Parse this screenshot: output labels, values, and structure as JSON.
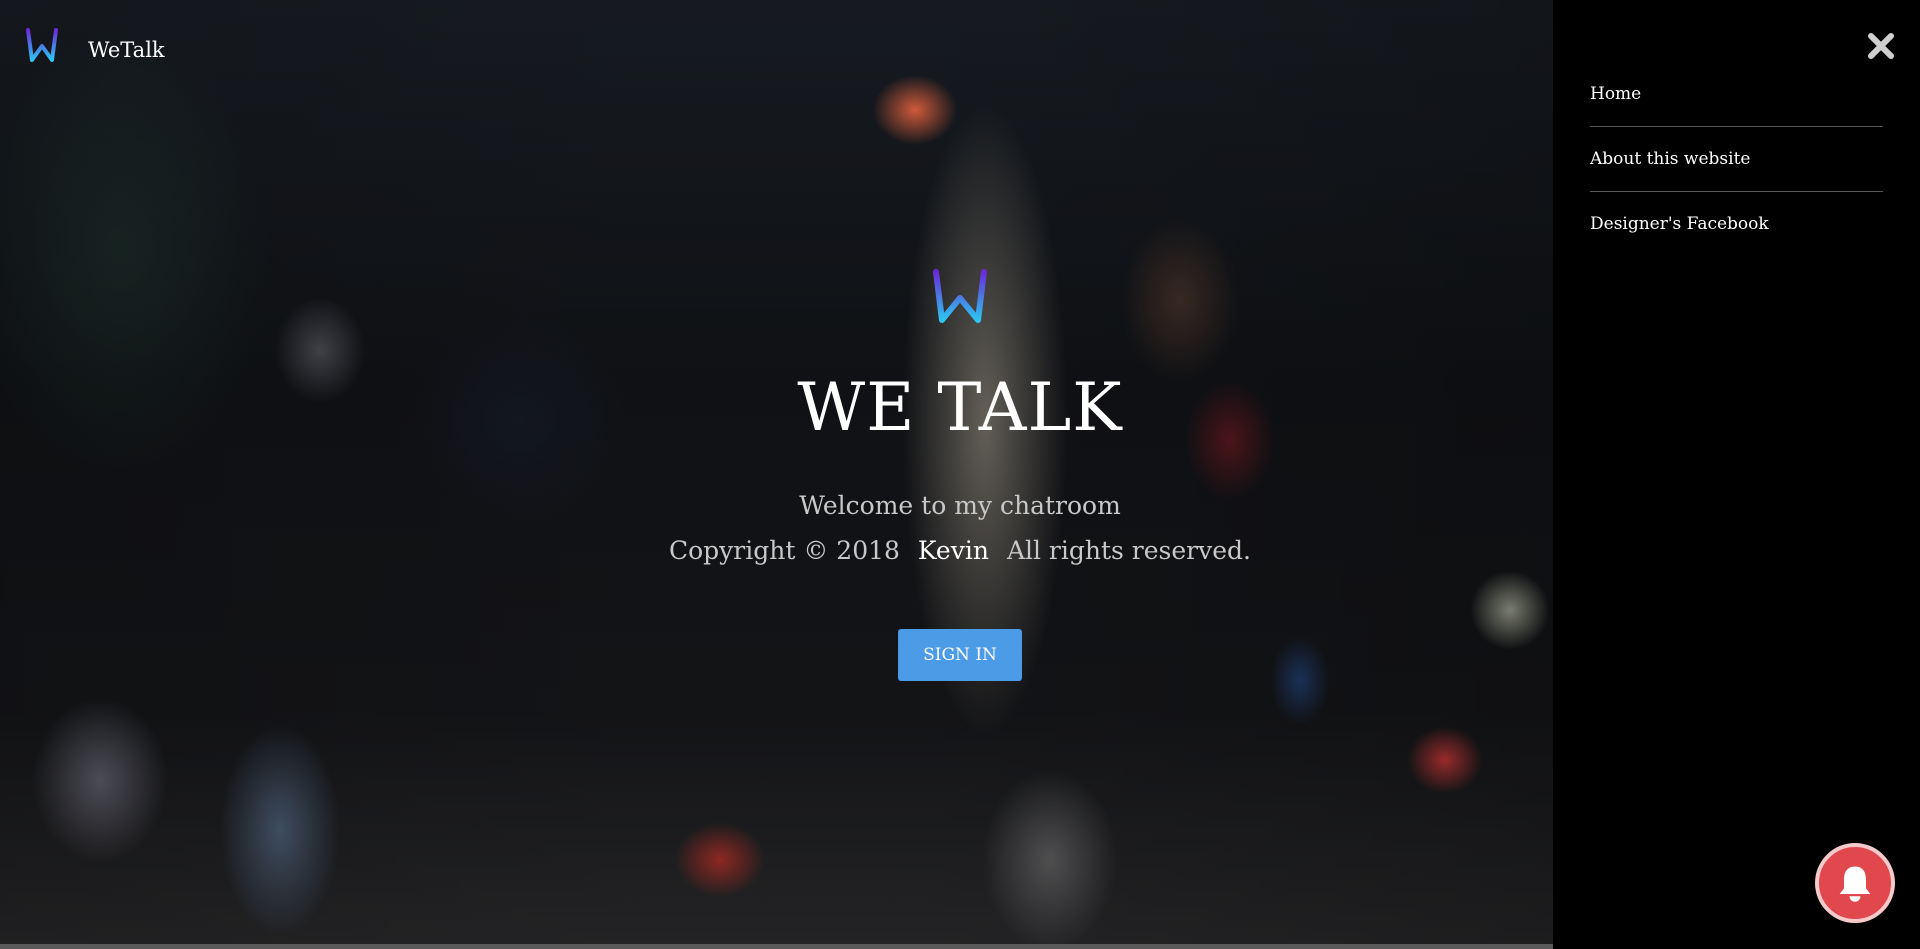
{
  "brand": {
    "name": "WeTalk",
    "logo_icon": "w-logo-icon"
  },
  "hero": {
    "logo_icon": "w-logo-icon",
    "title": "WE TALK",
    "subtitle": "Welcome to my chatroom",
    "copyright_prefix": "Copyright © 2018",
    "copyright_author": "Kevin",
    "copyright_suffix": "All rights reserved.",
    "signin_label": "SIGN IN"
  },
  "sidemenu": {
    "close_icon": "close-icon",
    "items": [
      {
        "label": "Home"
      },
      {
        "label": "About this website"
      },
      {
        "label": "Designer's Facebook"
      }
    ]
  },
  "notification": {
    "icon": "bell-icon"
  },
  "colors": {
    "signin_button": "#4c9be6",
    "notification_button": "#e0484e",
    "sidemenu_bg": "#000000",
    "logo_gradient_top": "#6a2bd9",
    "logo_gradient_bottom": "#2ec5f0"
  }
}
